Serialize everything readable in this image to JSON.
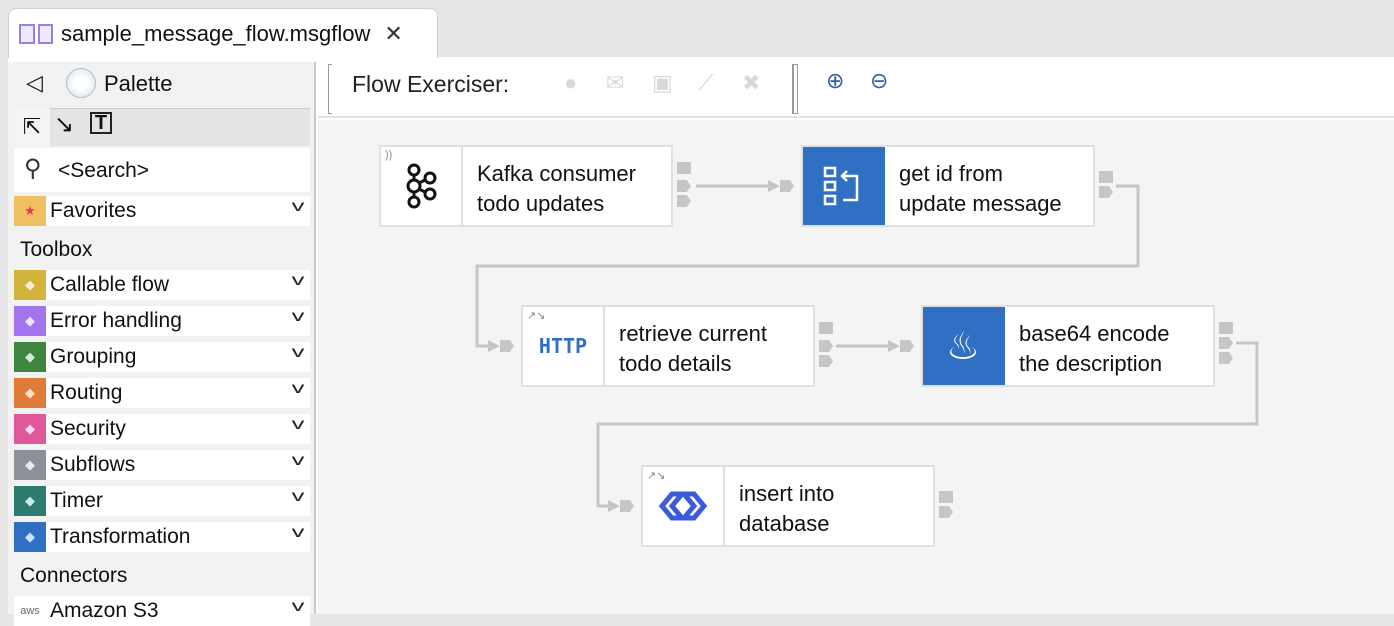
{
  "tab": {
    "title": "sample_message_flow.msgflow",
    "close_icon": "close-icon"
  },
  "palette": {
    "title": "Palette",
    "search_placeholder": "<Search>",
    "favorites": "Favorites",
    "toolbox_header": "Toolbox",
    "toolbox": [
      {
        "label": "Callable flow",
        "color": "#d4b33c"
      },
      {
        "label": "Error handling",
        "color": "#a374f0"
      },
      {
        "label": "Grouping",
        "color": "#3e8540"
      },
      {
        "label": "Routing",
        "color": "#e07b39"
      },
      {
        "label": "Security",
        "color": "#e0579a"
      },
      {
        "label": "Subflows",
        "color": "#8b9099"
      },
      {
        "label": "Timer",
        "color": "#2c7c70"
      },
      {
        "label": "Transformation",
        "color": "#2f6fc4"
      }
    ],
    "connectors_header": "Connectors",
    "connectors": [
      {
        "label": "Amazon S3",
        "icon_text": "aws"
      }
    ]
  },
  "toolbar": {
    "flow_exerciser_label": "Flow Exerciser:"
  },
  "nodes": [
    {
      "line1": "Kafka consumer",
      "line2": "todo updates",
      "icon": "kafka-icon"
    },
    {
      "line1": "get id from",
      "line2": "update message",
      "icon": "mapping-icon"
    },
    {
      "line1": "retrieve current",
      "line2": "todo details",
      "icon": "http-icon",
      "icon_text": "HTTP"
    },
    {
      "line1": "base64 encode",
      "line2": "the description",
      "icon": "java-icon"
    },
    {
      "line1": "insert into",
      "line2": "database",
      "icon": "loopback-icon"
    }
  ]
}
